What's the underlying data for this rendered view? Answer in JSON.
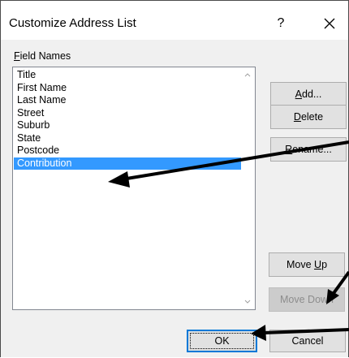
{
  "dialog": {
    "title": "Customize Address List",
    "help_label": "?",
    "close_icon": "close-icon"
  },
  "field_names": {
    "label_accel": "F",
    "label_rest": "ield Names",
    "items": [
      {
        "label": "Title",
        "selected": false
      },
      {
        "label": "First Name",
        "selected": false
      },
      {
        "label": "Last Name",
        "selected": false
      },
      {
        "label": "Street",
        "selected": false
      },
      {
        "label": "Suburb",
        "selected": false
      },
      {
        "label": "State",
        "selected": false
      },
      {
        "label": "Postcode",
        "selected": false
      },
      {
        "label": "Contribution",
        "selected": true
      }
    ]
  },
  "buttons": {
    "add": {
      "accel": "A",
      "rest": "dd..."
    },
    "delete": {
      "accel": "D",
      "rest": "elete"
    },
    "rename": {
      "accel": "R",
      "rest": "ename..."
    },
    "move_up": {
      "pre": "Move ",
      "accel": "U",
      "rest": "p"
    },
    "move_down": {
      "label": "Move Down",
      "disabled": true
    },
    "ok": "OK",
    "cancel": "Cancel"
  },
  "colors": {
    "selection": "#3399ff",
    "dialog_bg": "#f0f0f0",
    "focus_border": "#0078d7",
    "annotation_arrow": "#000000"
  }
}
